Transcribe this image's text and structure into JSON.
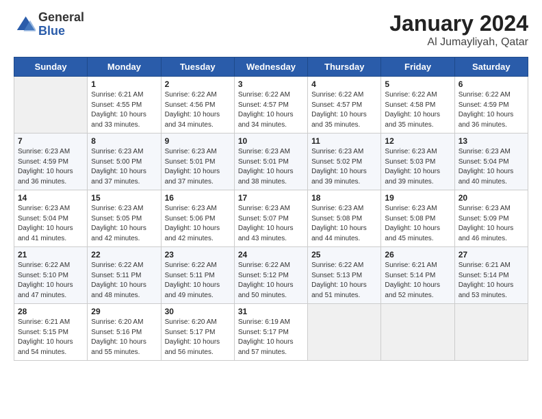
{
  "logo": {
    "general": "General",
    "blue": "Blue"
  },
  "title": "January 2024",
  "subtitle": "Al Jumayliyah, Qatar",
  "days_of_week": [
    "Sunday",
    "Monday",
    "Tuesday",
    "Wednesday",
    "Thursday",
    "Friday",
    "Saturday"
  ],
  "weeks": [
    [
      {
        "num": "",
        "empty": true
      },
      {
        "num": "1",
        "sunrise": "6:21 AM",
        "sunset": "4:55 PM",
        "daylight": "10 hours and 33 minutes."
      },
      {
        "num": "2",
        "sunrise": "6:22 AM",
        "sunset": "4:56 PM",
        "daylight": "10 hours and 34 minutes."
      },
      {
        "num": "3",
        "sunrise": "6:22 AM",
        "sunset": "4:57 PM",
        "daylight": "10 hours and 34 minutes."
      },
      {
        "num": "4",
        "sunrise": "6:22 AM",
        "sunset": "4:57 PM",
        "daylight": "10 hours and 35 minutes."
      },
      {
        "num": "5",
        "sunrise": "6:22 AM",
        "sunset": "4:58 PM",
        "daylight": "10 hours and 35 minutes."
      },
      {
        "num": "6",
        "sunrise": "6:22 AM",
        "sunset": "4:59 PM",
        "daylight": "10 hours and 36 minutes."
      }
    ],
    [
      {
        "num": "7",
        "sunrise": "6:23 AM",
        "sunset": "4:59 PM",
        "daylight": "10 hours and 36 minutes."
      },
      {
        "num": "8",
        "sunrise": "6:23 AM",
        "sunset": "5:00 PM",
        "daylight": "10 hours and 37 minutes."
      },
      {
        "num": "9",
        "sunrise": "6:23 AM",
        "sunset": "5:01 PM",
        "daylight": "10 hours and 37 minutes."
      },
      {
        "num": "10",
        "sunrise": "6:23 AM",
        "sunset": "5:01 PM",
        "daylight": "10 hours and 38 minutes."
      },
      {
        "num": "11",
        "sunrise": "6:23 AM",
        "sunset": "5:02 PM",
        "daylight": "10 hours and 39 minutes."
      },
      {
        "num": "12",
        "sunrise": "6:23 AM",
        "sunset": "5:03 PM",
        "daylight": "10 hours and 39 minutes."
      },
      {
        "num": "13",
        "sunrise": "6:23 AM",
        "sunset": "5:04 PM",
        "daylight": "10 hours and 40 minutes."
      }
    ],
    [
      {
        "num": "14",
        "sunrise": "6:23 AM",
        "sunset": "5:04 PM",
        "daylight": "10 hours and 41 minutes."
      },
      {
        "num": "15",
        "sunrise": "6:23 AM",
        "sunset": "5:05 PM",
        "daylight": "10 hours and 42 minutes."
      },
      {
        "num": "16",
        "sunrise": "6:23 AM",
        "sunset": "5:06 PM",
        "daylight": "10 hours and 42 minutes."
      },
      {
        "num": "17",
        "sunrise": "6:23 AM",
        "sunset": "5:07 PM",
        "daylight": "10 hours and 43 minutes."
      },
      {
        "num": "18",
        "sunrise": "6:23 AM",
        "sunset": "5:08 PM",
        "daylight": "10 hours and 44 minutes."
      },
      {
        "num": "19",
        "sunrise": "6:23 AM",
        "sunset": "5:08 PM",
        "daylight": "10 hours and 45 minutes."
      },
      {
        "num": "20",
        "sunrise": "6:23 AM",
        "sunset": "5:09 PM",
        "daylight": "10 hours and 46 minutes."
      }
    ],
    [
      {
        "num": "21",
        "sunrise": "6:22 AM",
        "sunset": "5:10 PM",
        "daylight": "10 hours and 47 minutes."
      },
      {
        "num": "22",
        "sunrise": "6:22 AM",
        "sunset": "5:11 PM",
        "daylight": "10 hours and 48 minutes."
      },
      {
        "num": "23",
        "sunrise": "6:22 AM",
        "sunset": "5:11 PM",
        "daylight": "10 hours and 49 minutes."
      },
      {
        "num": "24",
        "sunrise": "6:22 AM",
        "sunset": "5:12 PM",
        "daylight": "10 hours and 50 minutes."
      },
      {
        "num": "25",
        "sunrise": "6:22 AM",
        "sunset": "5:13 PM",
        "daylight": "10 hours and 51 minutes."
      },
      {
        "num": "26",
        "sunrise": "6:21 AM",
        "sunset": "5:14 PM",
        "daylight": "10 hours and 52 minutes."
      },
      {
        "num": "27",
        "sunrise": "6:21 AM",
        "sunset": "5:14 PM",
        "daylight": "10 hours and 53 minutes."
      }
    ],
    [
      {
        "num": "28",
        "sunrise": "6:21 AM",
        "sunset": "5:15 PM",
        "daylight": "10 hours and 54 minutes."
      },
      {
        "num": "29",
        "sunrise": "6:20 AM",
        "sunset": "5:16 PM",
        "daylight": "10 hours and 55 minutes."
      },
      {
        "num": "30",
        "sunrise": "6:20 AM",
        "sunset": "5:17 PM",
        "daylight": "10 hours and 56 minutes."
      },
      {
        "num": "31",
        "sunrise": "6:19 AM",
        "sunset": "5:17 PM",
        "daylight": "10 hours and 57 minutes."
      },
      {
        "num": "",
        "empty": true
      },
      {
        "num": "",
        "empty": true
      },
      {
        "num": "",
        "empty": true
      }
    ]
  ]
}
